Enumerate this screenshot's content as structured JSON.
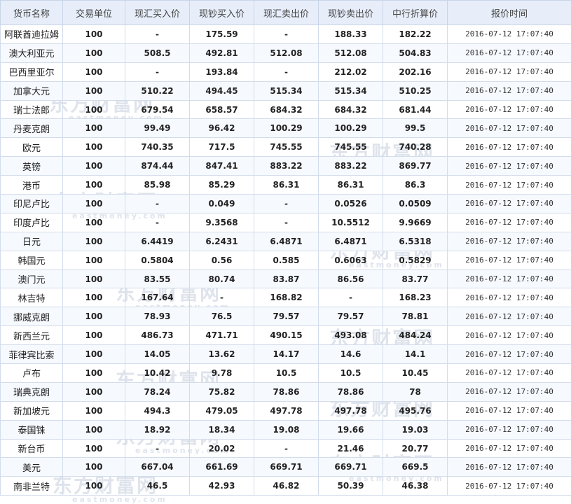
{
  "headers": [
    "货币名称",
    "交易单位",
    "现汇买入价",
    "现钞买入价",
    "现汇卖出价",
    "现钞卖出价",
    "中行折算价",
    "报价时间"
  ],
  "watermark": {
    "cn": "东方财富网",
    "en": "eastmoney.com"
  },
  "rows": [
    [
      "阿联酋迪拉姆",
      "100",
      "-",
      "175.59",
      "-",
      "188.33",
      "182.22",
      "2016-07-12 17:07:40"
    ],
    [
      "澳大利亚元",
      "100",
      "508.5",
      "492.81",
      "512.08",
      "512.08",
      "504.83",
      "2016-07-12 17:07:40"
    ],
    [
      "巴西里亚尔",
      "100",
      "-",
      "193.84",
      "-",
      "212.02",
      "202.16",
      "2016-07-12 17:07:40"
    ],
    [
      "加拿大元",
      "100",
      "510.22",
      "494.45",
      "515.34",
      "515.34",
      "510.25",
      "2016-07-12 17:07:40"
    ],
    [
      "瑞士法郎",
      "100",
      "679.54",
      "658.57",
      "684.32",
      "684.32",
      "681.44",
      "2016-07-12 17:07:40"
    ],
    [
      "丹麦克朗",
      "100",
      "99.49",
      "96.42",
      "100.29",
      "100.29",
      "99.5",
      "2016-07-12 17:07:40"
    ],
    [
      "欧元",
      "100",
      "740.35",
      "717.5",
      "745.55",
      "745.55",
      "740.28",
      "2016-07-12 17:07:40"
    ],
    [
      "英镑",
      "100",
      "874.44",
      "847.41",
      "883.22",
      "883.22",
      "869.77",
      "2016-07-12 17:07:40"
    ],
    [
      "港币",
      "100",
      "85.98",
      "85.29",
      "86.31",
      "86.31",
      "86.3",
      "2016-07-12 17:07:40"
    ],
    [
      "印尼卢比",
      "100",
      "-",
      "0.049",
      "-",
      "0.0526",
      "0.0509",
      "2016-07-12 17:07:40"
    ],
    [
      "印度卢比",
      "100",
      "-",
      "9.3568",
      "-",
      "10.5512",
      "9.9669",
      "2016-07-12 17:07:40"
    ],
    [
      "日元",
      "100",
      "6.4419",
      "6.2431",
      "6.4871",
      "6.4871",
      "6.5318",
      "2016-07-12 17:07:40"
    ],
    [
      "韩国元",
      "100",
      "0.5804",
      "0.56",
      "0.585",
      "0.6063",
      "0.5829",
      "2016-07-12 17:07:40"
    ],
    [
      "澳门元",
      "100",
      "83.55",
      "80.74",
      "83.87",
      "86.56",
      "83.77",
      "2016-07-12 17:07:40"
    ],
    [
      "林吉特",
      "100",
      "167.64",
      "-",
      "168.82",
      "-",
      "168.23",
      "2016-07-12 17:07:40"
    ],
    [
      "挪威克朗",
      "100",
      "78.93",
      "76.5",
      "79.57",
      "79.57",
      "78.81",
      "2016-07-12 17:07:40"
    ],
    [
      "新西兰元",
      "100",
      "486.73",
      "471.71",
      "490.15",
      "493.08",
      "484.24",
      "2016-07-12 17:07:40"
    ],
    [
      "菲律宾比索",
      "100",
      "14.05",
      "13.62",
      "14.17",
      "14.6",
      "14.1",
      "2016-07-12 17:07:40"
    ],
    [
      "卢布",
      "100",
      "10.42",
      "9.78",
      "10.5",
      "10.5",
      "10.45",
      "2016-07-12 17:07:40"
    ],
    [
      "瑞典克朗",
      "100",
      "78.24",
      "75.82",
      "78.86",
      "78.86",
      "78",
      "2016-07-12 17:07:40"
    ],
    [
      "新加坡元",
      "100",
      "494.3",
      "479.05",
      "497.78",
      "497.78",
      "495.76",
      "2016-07-12 17:07:40"
    ],
    [
      "泰国铢",
      "100",
      "18.92",
      "18.34",
      "19.08",
      "19.66",
      "19.03",
      "2016-07-12 17:07:40"
    ],
    [
      "新台币",
      "100",
      "-",
      "20.02",
      "-",
      "21.46",
      "20.77",
      "2016-07-12 17:07:40"
    ],
    [
      "美元",
      "100",
      "667.04",
      "661.69",
      "669.71",
      "669.71",
      "669.5",
      "2016-07-12 17:07:40"
    ],
    [
      "南非兰特",
      "100",
      "46.5",
      "42.93",
      "46.82",
      "50.39",
      "46.38",
      "2016-07-12 17:07:40"
    ]
  ]
}
